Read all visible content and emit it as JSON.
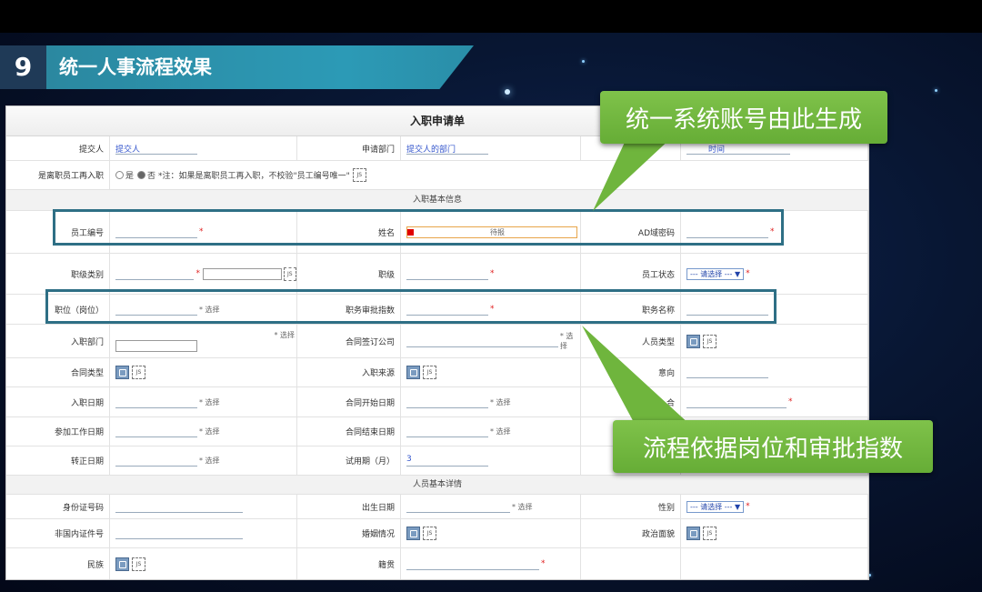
{
  "header": {
    "number": "9",
    "title": "统一人事流程效果"
  },
  "form": {
    "title": "入职申请单",
    "rows": {
      "submitter": {
        "label": "提交人",
        "value": "提交人",
        "dept_label": "申请部门",
        "dept_value": "提交人的部门",
        "time_value": "时间"
      },
      "rehire": {
        "label": "是离职员工再入职",
        "yes": "是",
        "no": "否",
        "note": "*注：如果是离职员工再入职，不校验\"员工编号唯一\""
      },
      "section_basic": "入职基本信息",
      "employee": {
        "id_label": "员工编号",
        "name_label": "姓名",
        "name_placeholder": "待报",
        "ad_label": "AD域密码"
      },
      "level": {
        "type_label": "职级类别",
        "level_label": "职级",
        "status_label": "员工状态",
        "status_value": "--- 请选择 --- ▼"
      },
      "position": {
        "pos_label": "职位（岗位）",
        "approve_label": "职务审批指数",
        "title_label": "职务名称"
      },
      "hire_dept": {
        "dept_label": "入职部门",
        "company_label": "合同签订公司",
        "ptype_label": "人员类型"
      },
      "contract": {
        "type_label": "合同类型",
        "source_label": "入职来源",
        "dir_label": "意向"
      },
      "dates1": {
        "hire_label": "入职日期",
        "start_label": "合同开始日期",
        "third_label": "合"
      },
      "dates2": {
        "work_label": "参加工作日期",
        "end_label": "合同结束日期"
      },
      "dates3": {
        "regular_label": "转正日期",
        "probation_label": "试用期（月）",
        "probation_value": "3"
      },
      "section_detail": "人员基本详情",
      "idcard": {
        "id_label": "身份证号码",
        "birth_label": "出生日期",
        "gender_label": "性别",
        "gender_value": "--- 请选择 --- ▼"
      },
      "foreign": {
        "foreign_label": "非国内证件号",
        "marital_label": "婚姻情况",
        "political_label": "政治面貌"
      },
      "ethnic": {
        "ethnic_label": "民族",
        "native_label": "籍贯"
      }
    },
    "common": {
      "required": "*",
      "choose": "选择",
      "required_choose": "* 选择",
      "js": "JS"
    }
  },
  "callouts": {
    "account": "统一系统账号由此生成",
    "process": "流程依据岗位和审批指数"
  },
  "colors": {
    "callout_green": "#72b840",
    "highlight_border": "#2e6f85",
    "banner_blue": "#2c9ab6"
  }
}
